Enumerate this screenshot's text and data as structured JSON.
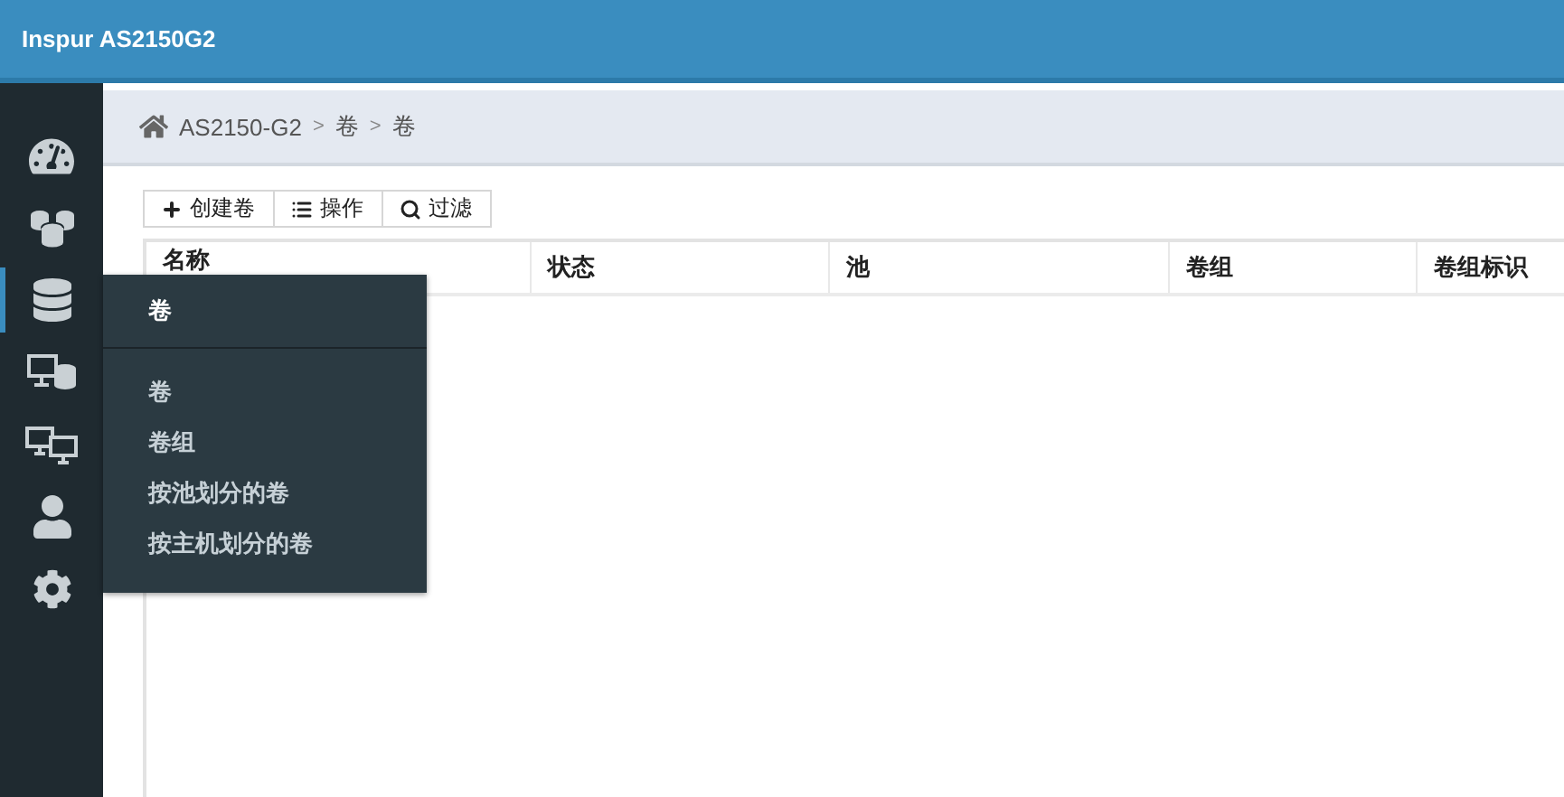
{
  "header": {
    "title": "Inspur AS2150G2"
  },
  "sidebar": {
    "items": [
      {
        "selected": false
      },
      {
        "selected": false
      },
      {
        "selected": true
      },
      {
        "selected": false
      },
      {
        "selected": false
      },
      {
        "selected": false
      },
      {
        "selected": false
      }
    ]
  },
  "breadcrumb": [
    "AS2150-G2",
    "卷",
    "卷"
  ],
  "breadcrumb_separator": ">",
  "toolbar": [
    {
      "kind": "add",
      "label": "创建卷"
    },
    {
      "kind": "list",
      "label": "操作"
    },
    {
      "kind": "search",
      "label": "过滤"
    }
  ],
  "table": {
    "columns": [
      "名称",
      "状态",
      "池",
      "卷组",
      "卷组标识"
    ]
  },
  "flyout": {
    "title": "卷",
    "items": [
      "卷",
      "卷组",
      "按池划分的卷",
      "按主机划分的卷"
    ]
  }
}
